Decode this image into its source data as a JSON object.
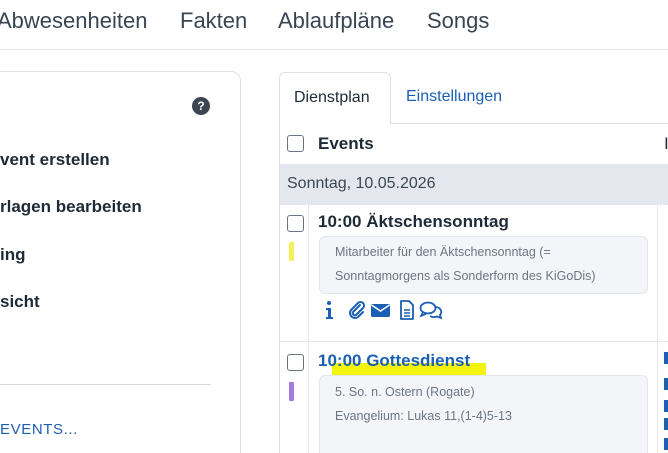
{
  "topnav": {
    "items": [
      "Abwesenheiten",
      "Fakten",
      "Ablaufpläne",
      "Songs"
    ]
  },
  "sidebar": {
    "help_label": "?",
    "items": [
      {
        "label": "vent erstellen"
      },
      {
        "label": "rlagen bearbeiten"
      },
      {
        "label": "ing"
      },
      {
        "label": "sicht"
      }
    ],
    "events_link": "EVENTS..."
  },
  "tabs": [
    {
      "label": "Dienstplan",
      "active": true
    },
    {
      "label": "Einstellungen",
      "active": false
    }
  ],
  "table": {
    "column_events": "Events",
    "column_right_edge": "I",
    "date_group": "Sonntag, 10.05.2026",
    "events": [
      {
        "title": "10:00 Äktschensonntag",
        "title_color": "#1f2a37",
        "bar_color": "#f5ef5a",
        "note_lines": [
          "Mitarbeiter für den Äktschensonntag (=",
          "Sonntagmorgens als Sonderform des KiGoDis)"
        ],
        "icons": [
          "info-icon",
          "paperclip-icon",
          "envelope-icon",
          "document-icon",
          "chat-icon"
        ]
      },
      {
        "title": "10:00 Gottesdienst",
        "title_color": "#1a5fb4",
        "bar_color": "#a77ad9",
        "note_lines": [
          "5. So. n. Ostern (Rogate)",
          "Evangelium: Lukas 11,(1-4)5-13"
        ]
      }
    ]
  },
  "colors": {
    "accent": "#1a5fb4",
    "highlight": "#f3f40d",
    "date_row_bg": "#e4e8ee"
  }
}
